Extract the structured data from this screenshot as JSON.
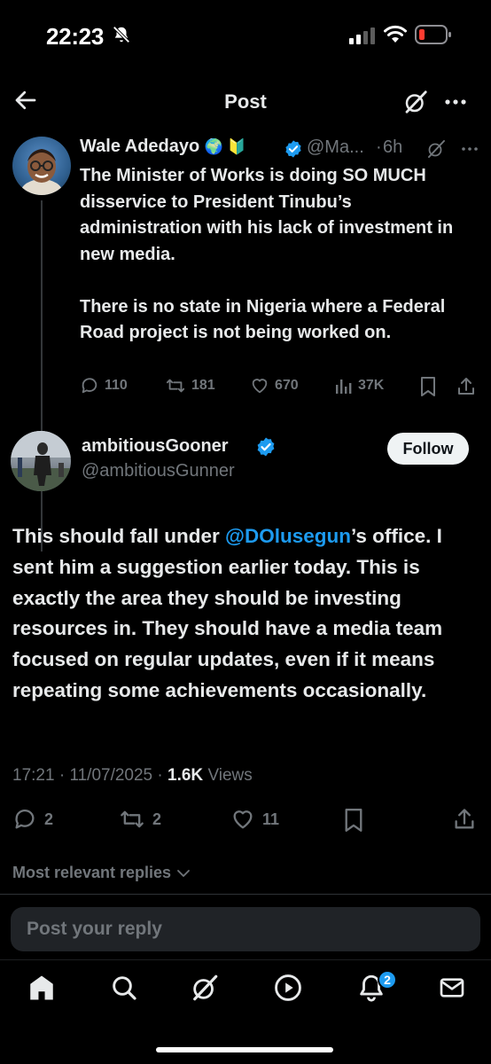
{
  "status_bar": {
    "time": "22:23"
  },
  "header": {
    "title": "Post"
  },
  "parent_tweet": {
    "name": "Wale Adedayo",
    "name_emojis": "🌍 🔰",
    "handle": "@Ma...",
    "time": "6h",
    "text": "The Minister of Works is doing SO MUCH disservice to President Tinubu’s administration with his lack of investment in new media.\n\nThere is no state in Nigeria where a Federal Road project is not being worked on.",
    "replies": "110",
    "reposts": "181",
    "likes": "670",
    "views": "37K"
  },
  "main_tweet": {
    "name": "ambitiousGooner",
    "handle": "@ambitiousGunner",
    "follow_label": "Follow",
    "text_before": "This should fall under ",
    "mention": "@DOlusegun",
    "text_after": "’s office. I sent him a suggestion earlier today. This is exactly the area they should be investing resources in. They should have a media team focused on regular updates, even if it means repeating some achievements occasionally.",
    "time": "17:21",
    "date": "11/07/2025",
    "views_count": "1.6K",
    "views_label": "Views",
    "replies": "2",
    "reposts": "2",
    "likes": "11"
  },
  "replies_filter": "Most relevant replies",
  "reply_placeholder": "Post your reply",
  "tabbar": {
    "notifications_badge": "2"
  },
  "colors": {
    "accent": "#1d9bf0",
    "background": "#000000",
    "muted": "#71767b",
    "text": "#e7e9ea",
    "battery_low": "#ff3b30"
  },
  "icons": [
    "back-arrow-icon",
    "grok-icon",
    "more-icon",
    "verified-badge-icon",
    "reply-icon",
    "repost-icon",
    "like-icon",
    "views-icon",
    "bookmark-icon",
    "share-icon",
    "home-icon",
    "search-icon",
    "video-icon",
    "notifications-icon",
    "messages-icon"
  ]
}
